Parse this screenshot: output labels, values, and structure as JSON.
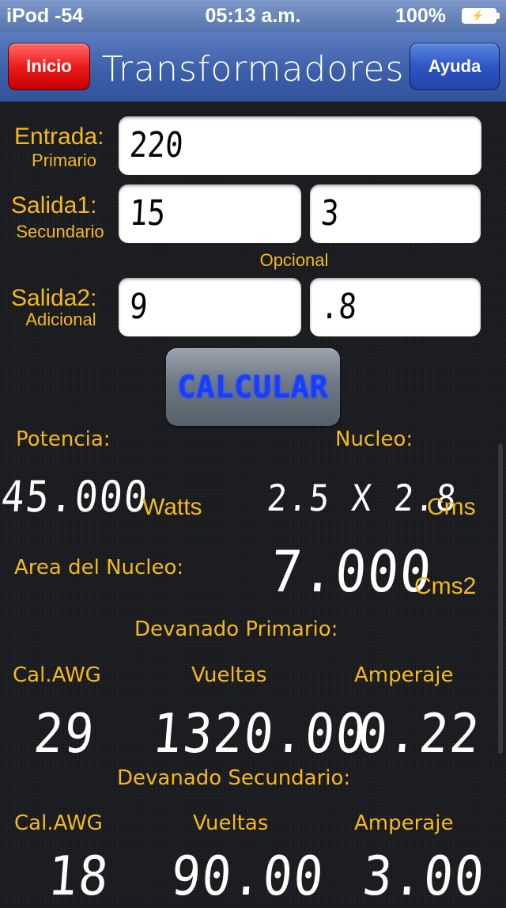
{
  "status": {
    "carrier": "iPod -54",
    "time": "05:13 a.m.",
    "battery": "100%"
  },
  "nav": {
    "title": "Transformadores",
    "left_button": "Inicio",
    "right_button": "Ayuda"
  },
  "form": {
    "entrada": {
      "label": "Entrada:",
      "sublabel": "Primario",
      "value": "220"
    },
    "salida1": {
      "label": "Salida1:",
      "sublabel": "Secundario",
      "value_v": "15",
      "value_a": "3"
    },
    "opcional": "Opcional",
    "salida2": {
      "label": "Salida2:",
      "sublabel": "Adicional",
      "value_v": "9",
      "value_a": ".8"
    },
    "calc_button": "CALCULAR"
  },
  "results": {
    "potencia_label": "Potencia:",
    "potencia_value": "45.000",
    "potencia_unit": "Watts",
    "nucleo_label": "Nucleo:",
    "nucleo_value": "2.5 X 2.8",
    "nucleo_unit": "Cms",
    "area_label": "Area del Nucleo:",
    "area_value": "7.000",
    "area_unit": "Cms2",
    "primario": {
      "title": "Devanado Primario:",
      "col1": "Cal.AWG",
      "col2": "Vueltas",
      "col3": "Amperaje",
      "awg": "29",
      "vueltas": "1320.00",
      "amperaje": "0.22"
    },
    "secundario": {
      "title": "Devanado Secundario:",
      "col1": "Cal.AWG",
      "col2": "Vueltas",
      "col3": "Amperaje",
      "awg": "18",
      "vueltas": "90.00",
      "amperaje": "3.00"
    }
  }
}
